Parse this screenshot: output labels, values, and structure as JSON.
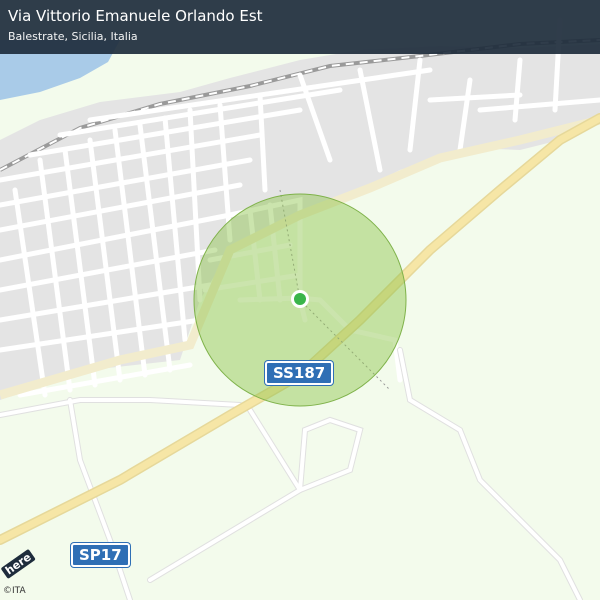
{
  "header": {
    "title": "Via Vittorio Emanuele Orlando Est",
    "subtitle": "Balestrate, Sicilia, Italia"
  },
  "map": {
    "road_shields": [
      {
        "id": "ss187",
        "label": "SS187"
      },
      {
        "id": "sp17",
        "label": "SP17"
      }
    ],
    "logo_text": "here",
    "copyright": "©ITA",
    "colors": {
      "land": "#f3fbec",
      "urban": "#e4e4e4",
      "water": "#a9cbe8",
      "main_road": "#f6e6a6",
      "street": "#ffffff",
      "accuracy_circle": "#8bc34a",
      "location_dot": "#3ab54a",
      "shield": "#2f6fb5"
    }
  }
}
